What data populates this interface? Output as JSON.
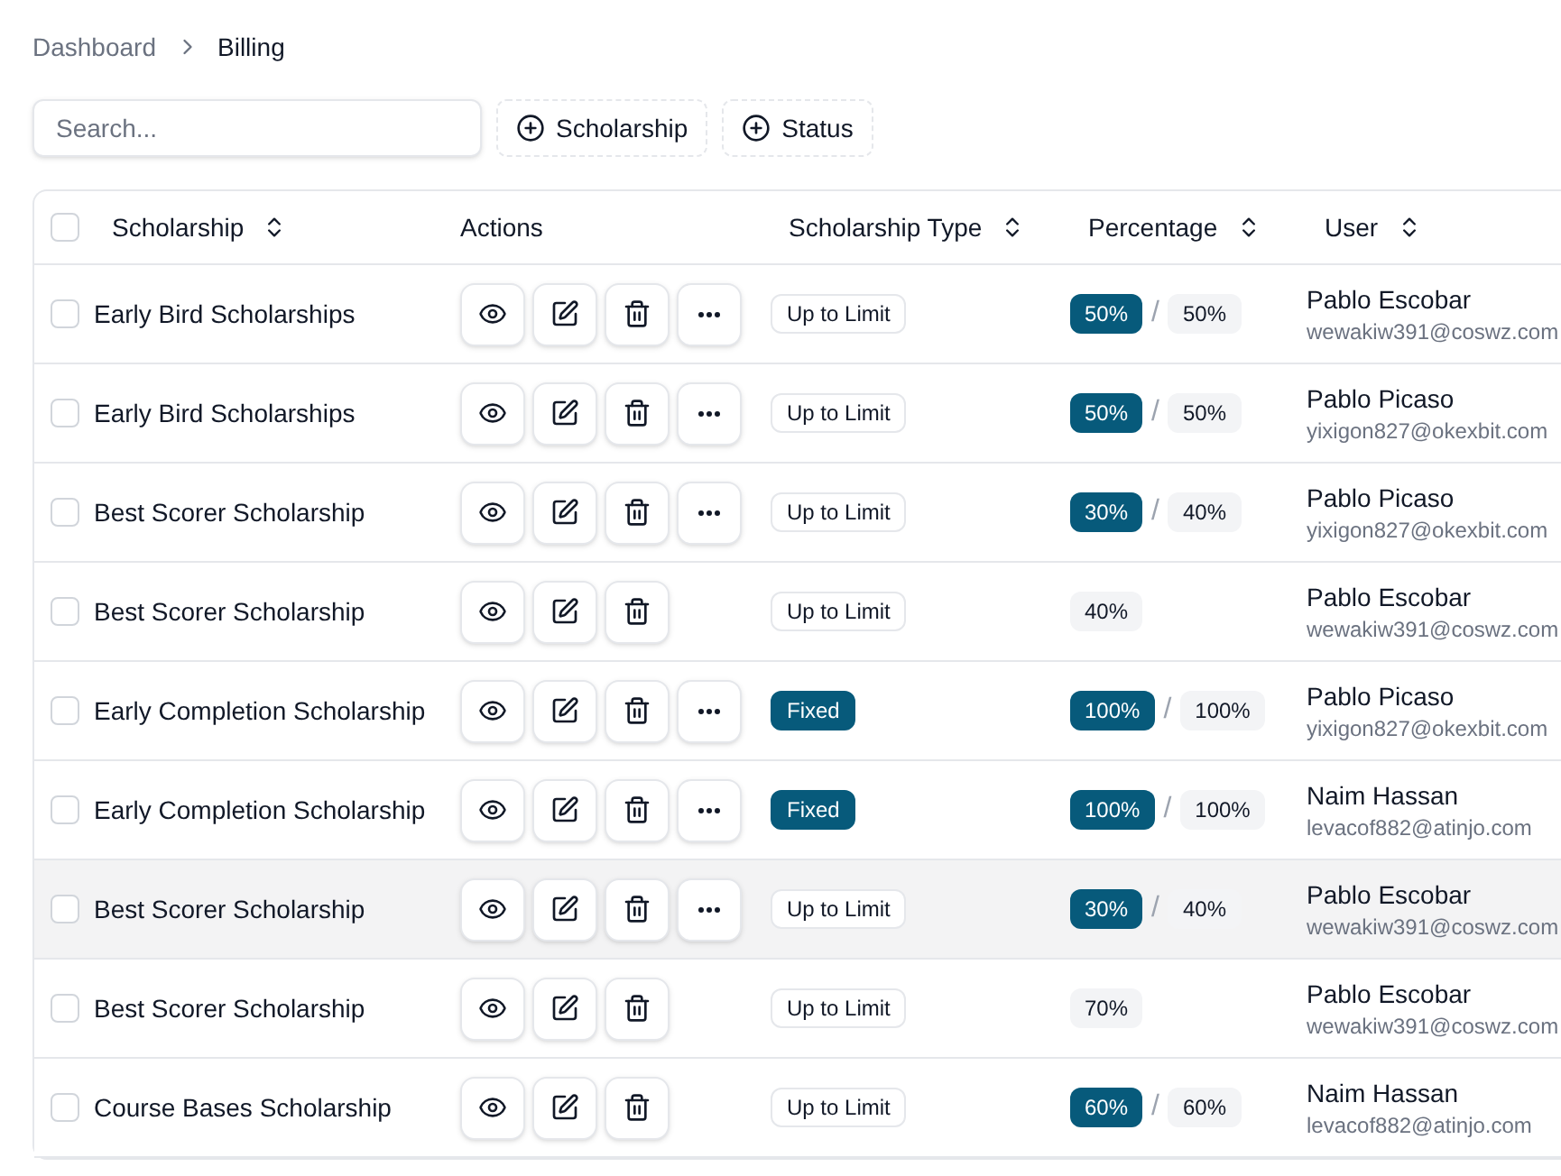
{
  "breadcrumb": [
    {
      "label": "Dashboard",
      "current": false
    },
    {
      "label": "Billing",
      "current": true
    }
  ],
  "search": {
    "placeholder": "Search..."
  },
  "filters": [
    {
      "label": "Scholarship"
    },
    {
      "label": "Status"
    }
  ],
  "table": {
    "header_checkbox": {
      "checked": false
    },
    "columns": [
      {
        "label": "Scholarship",
        "sortable": true
      },
      {
        "label": "Actions",
        "sortable": false
      },
      {
        "label": "Scholarship Type",
        "sortable": true
      },
      {
        "label": "Percentage",
        "sortable": true
      },
      {
        "label": "User",
        "sortable": true
      }
    ],
    "rows": [
      {
        "checked": false,
        "hovered": false,
        "scholarship": "Early Bird Scholarships",
        "actions": [
          {
            "kind": "view"
          },
          {
            "kind": "edit"
          },
          {
            "kind": "delete"
          },
          {
            "kind": "more"
          }
        ],
        "type": {
          "label": "Up to Limit",
          "kind": "outline"
        },
        "percentage": {
          "granted": "50%",
          "separator": "/",
          "limit": "50%"
        },
        "user": {
          "name": "Pablo Escobar",
          "email": "wewakiw391@coswz.com"
        }
      },
      {
        "checked": false,
        "hovered": false,
        "scholarship": "Early Bird Scholarships",
        "actions": [
          {
            "kind": "view"
          },
          {
            "kind": "edit"
          },
          {
            "kind": "delete"
          },
          {
            "kind": "more"
          }
        ],
        "type": {
          "label": "Up to Limit",
          "kind": "outline"
        },
        "percentage": {
          "granted": "50%",
          "separator": "/",
          "limit": "50%"
        },
        "user": {
          "name": "Pablo Picaso",
          "email": "yixigon827@okexbit.com"
        }
      },
      {
        "checked": false,
        "hovered": false,
        "scholarship": "Best Scorer Scholarship",
        "actions": [
          {
            "kind": "view"
          },
          {
            "kind": "edit"
          },
          {
            "kind": "delete"
          },
          {
            "kind": "more"
          }
        ],
        "type": {
          "label": "Up to Limit",
          "kind": "outline"
        },
        "percentage": {
          "granted": "30%",
          "separator": "/",
          "limit": "40%"
        },
        "user": {
          "name": "Pablo Picaso",
          "email": "yixigon827@okexbit.com"
        }
      },
      {
        "checked": false,
        "hovered": false,
        "scholarship": "Best Scorer Scholarship",
        "actions": [
          {
            "kind": "view"
          },
          {
            "kind": "edit"
          },
          {
            "kind": "delete"
          }
        ],
        "type": {
          "label": "Up to Limit",
          "kind": "outline"
        },
        "percentage": {
          "limit": "40%"
        },
        "user": {
          "name": "Pablo Escobar",
          "email": "wewakiw391@coswz.com"
        }
      },
      {
        "checked": false,
        "hovered": false,
        "scholarship": "Early Completion Scholarship",
        "actions": [
          {
            "kind": "view"
          },
          {
            "kind": "edit"
          },
          {
            "kind": "delete"
          },
          {
            "kind": "more"
          }
        ],
        "type": {
          "label": "Fixed",
          "kind": "filled"
        },
        "percentage": {
          "granted": "100%",
          "separator": "/",
          "limit": "100%"
        },
        "user": {
          "name": "Pablo Picaso",
          "email": "yixigon827@okexbit.com"
        }
      },
      {
        "checked": false,
        "hovered": false,
        "scholarship": "Early Completion Scholarship",
        "actions": [
          {
            "kind": "view"
          },
          {
            "kind": "edit"
          },
          {
            "kind": "delete"
          },
          {
            "kind": "more"
          }
        ],
        "type": {
          "label": "Fixed",
          "kind": "filled"
        },
        "percentage": {
          "granted": "100%",
          "separator": "/",
          "limit": "100%"
        },
        "user": {
          "name": "Naim Hassan",
          "email": "levacof882@atinjo.com"
        }
      },
      {
        "checked": false,
        "hovered": true,
        "scholarship": "Best Scorer Scholarship",
        "actions": [
          {
            "kind": "view"
          },
          {
            "kind": "edit"
          },
          {
            "kind": "delete"
          },
          {
            "kind": "more"
          }
        ],
        "type": {
          "label": "Up to Limit",
          "kind": "outline"
        },
        "percentage": {
          "granted": "30%",
          "separator": "/",
          "limit": "40%"
        },
        "user": {
          "name": "Pablo Escobar",
          "email": "wewakiw391@coswz.com"
        }
      },
      {
        "checked": false,
        "hovered": false,
        "scholarship": "Best Scorer Scholarship",
        "actions": [
          {
            "kind": "view"
          },
          {
            "kind": "edit"
          },
          {
            "kind": "delete"
          }
        ],
        "type": {
          "label": "Up to Limit",
          "kind": "outline"
        },
        "percentage": {
          "limit": "70%"
        },
        "user": {
          "name": "Pablo Escobar",
          "email": "wewakiw391@coswz.com"
        }
      },
      {
        "checked": false,
        "hovered": false,
        "scholarship": "Course Bases Scholarship",
        "actions": [
          {
            "kind": "view"
          },
          {
            "kind": "edit"
          },
          {
            "kind": "delete"
          }
        ],
        "type": {
          "label": "Up to Limit",
          "kind": "outline"
        },
        "percentage": {
          "granted": "60%",
          "separator": "/",
          "limit": "60%"
        },
        "user": {
          "name": "Naim Hassan",
          "email": "levacof882@atinjo.com"
        }
      }
    ]
  }
}
